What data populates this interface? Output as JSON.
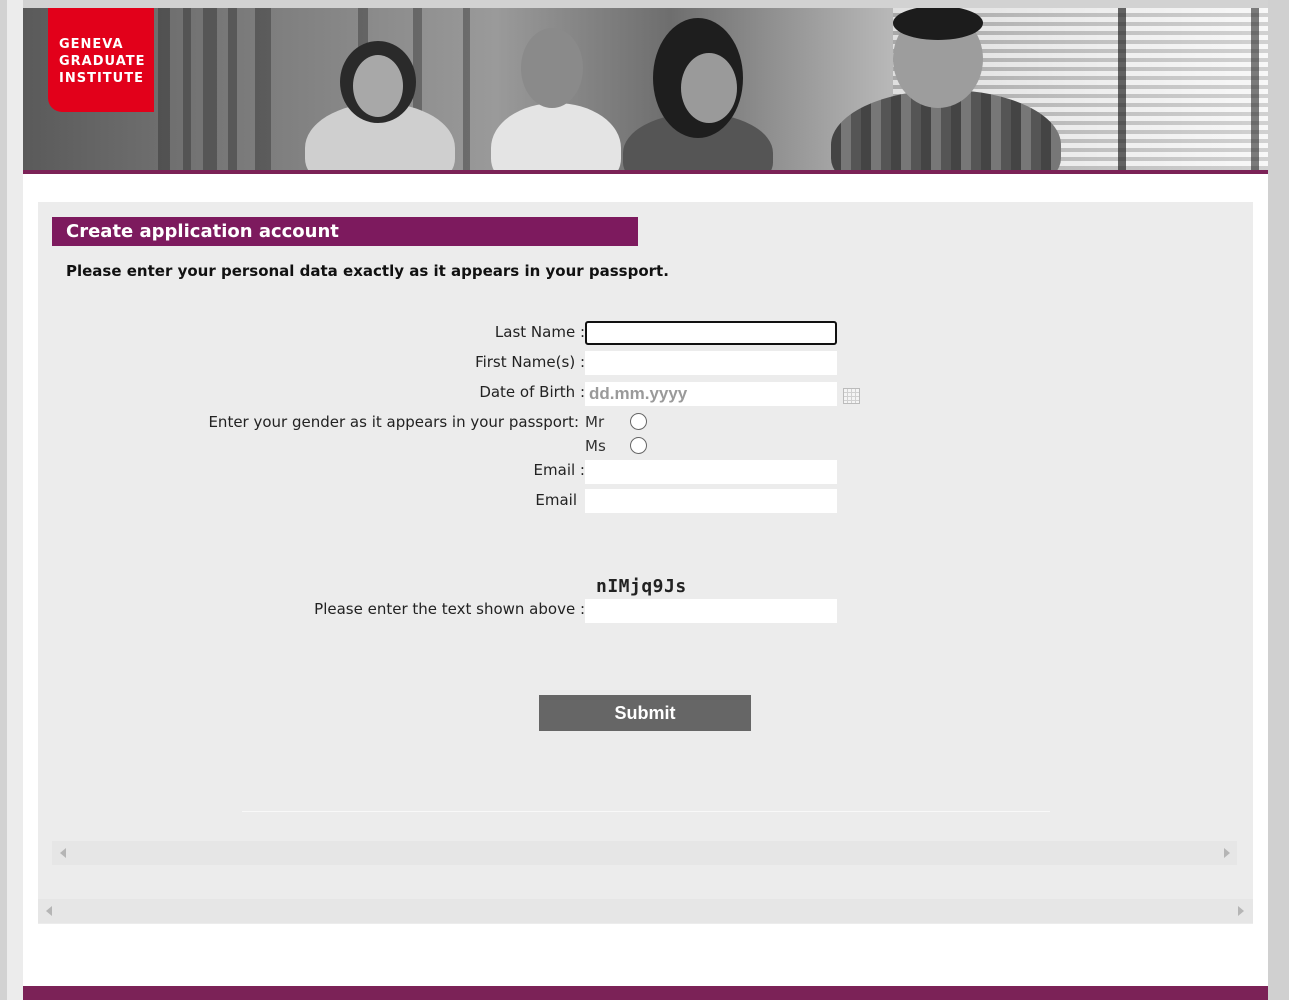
{
  "logo": {
    "lines": [
      "GENEVA",
      "GRADUATE",
      "INSTITUTE"
    ]
  },
  "form": {
    "title": "Create application account",
    "instructions": "Please enter your personal data exactly as it appears in your passport.",
    "last_name_label": "Last Name :",
    "last_name_value": "",
    "first_name_label": "First Name(s) :",
    "first_name_value": "",
    "dob_label": "Date of Birth :",
    "dob_placeholder": "dd.mm.yyyy",
    "gender_label": "Enter your gender as it appears in your passport:",
    "gender_options": [
      "Mr",
      "Ms"
    ],
    "email_label": "Email :",
    "email_value": "",
    "email_confirm_label": "Email",
    "email_confirm_value": "",
    "captcha_text": "nIMjq9Js",
    "captcha_label": "Please enter the text shown above :",
    "captcha_value": "",
    "submit_label": "Submit"
  },
  "colors": {
    "accent_purple": "#7d1a5e",
    "logo_red": "#e2001a",
    "button_gray": "#666666",
    "panel_bg": "#ececec"
  },
  "icons": [
    "calendar-icon",
    "scroll-left-arrow-icon",
    "scroll-right-arrow-icon"
  ]
}
